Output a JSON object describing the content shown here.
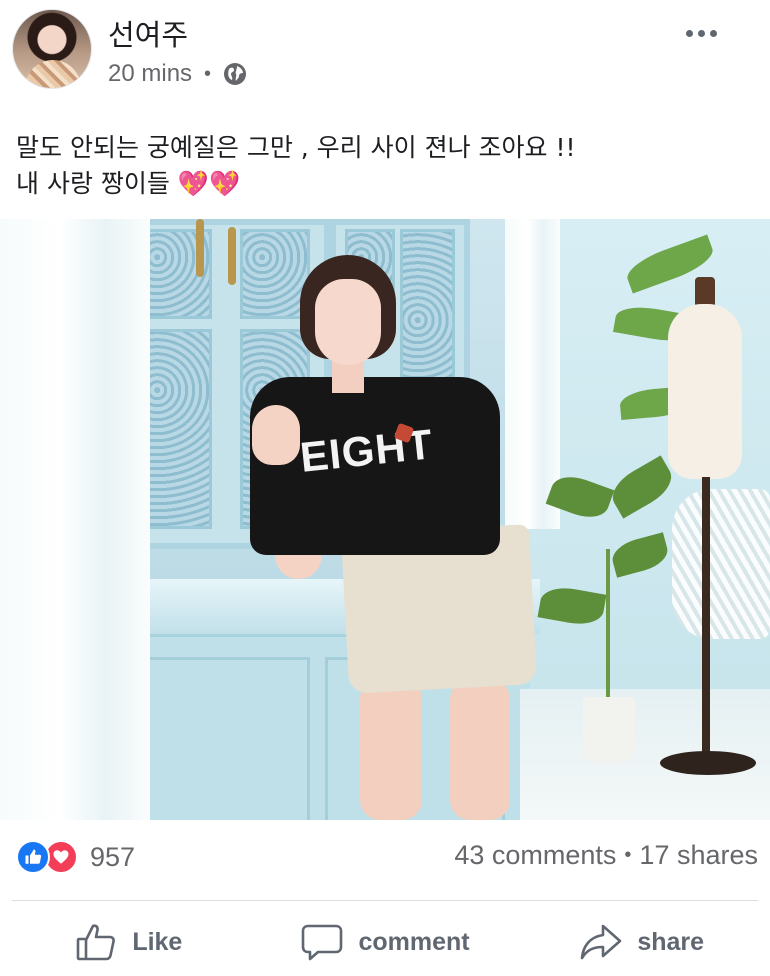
{
  "post": {
    "author": "선여주",
    "time": "20 mins",
    "caption_line1": "말도 안되는 궁예질은 그만 , 우리 사이 젼나 조아요 !!",
    "caption_line2": "내 사랑 짱이들 💖💖"
  },
  "photo": {
    "shirt_text": "EIGHT"
  },
  "reactions": {
    "count": "957",
    "comments": "43 comments",
    "shares": "17 shares"
  },
  "actions": {
    "like_label": "Like",
    "comment_label": "comment",
    "share_label": "share"
  },
  "icons": [
    "globe-icon",
    "more-icon",
    "like-reaction-icon",
    "love-reaction-icon",
    "thumbs-up-icon",
    "comment-bubble-icon",
    "share-arrow-icon"
  ],
  "colors": {
    "like_blue": "#1877f2",
    "love_red": "#f33e58",
    "secondary_text": "#65676b"
  }
}
